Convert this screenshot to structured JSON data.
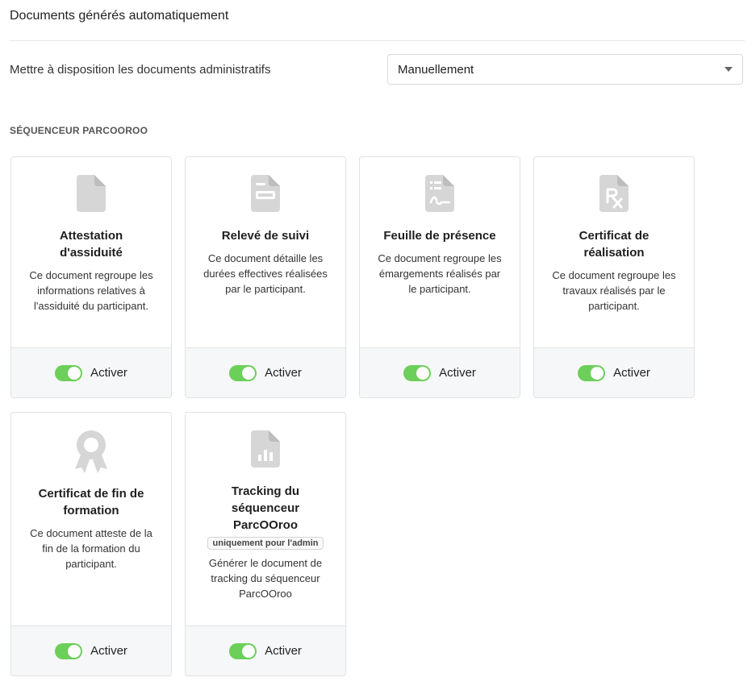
{
  "header": {
    "title": "Documents générés automatiquement"
  },
  "setting": {
    "label": "Mettre à disposition les documents administratifs",
    "selected": "Manuellement"
  },
  "group": {
    "label": "SÉQUENCEUR PARCOOROO"
  },
  "cards": [
    {
      "title": "Attestation d'assiduité",
      "description": "Ce document regroupe les informations relatives à l'assiduité du participant.",
      "icon": "file-icon",
      "toggle_label": "Activer",
      "enabled": true
    },
    {
      "title": "Relevé de suivi",
      "description": "Ce document détaille les durées effectives réalisées par le participant.",
      "icon": "file-invoice-icon",
      "toggle_label": "Activer",
      "enabled": true
    },
    {
      "title": "Feuille de présence",
      "description": "Ce document regroupe les émargements réalisés par le participant.",
      "icon": "file-signature-icon",
      "toggle_label": "Activer",
      "enabled": true
    },
    {
      "title": "Certificat de réalisation",
      "description": "Ce document regroupe les travaux réalisés par le participant.",
      "icon": "file-prescription-icon",
      "toggle_label": "Activer",
      "enabled": true
    },
    {
      "title": "Certificat de fin de formation",
      "description": "Ce document atteste de la fin de la formation du participant.",
      "icon": "award-icon",
      "toggle_label": "Activer",
      "enabled": true
    },
    {
      "title": "Tracking du séquenceur ParcOOroo",
      "badge": "uniquement pour l'admin",
      "description": "Générer le document de tracking du séquenceur ParcOOroo",
      "icon": "file-chart-icon",
      "toggle_label": "Activer",
      "enabled": true
    }
  ],
  "colors": {
    "toggle_on": "#6ccf5a",
    "icon": "#d6d6d6",
    "footer_bg": "#f6f7f9"
  }
}
